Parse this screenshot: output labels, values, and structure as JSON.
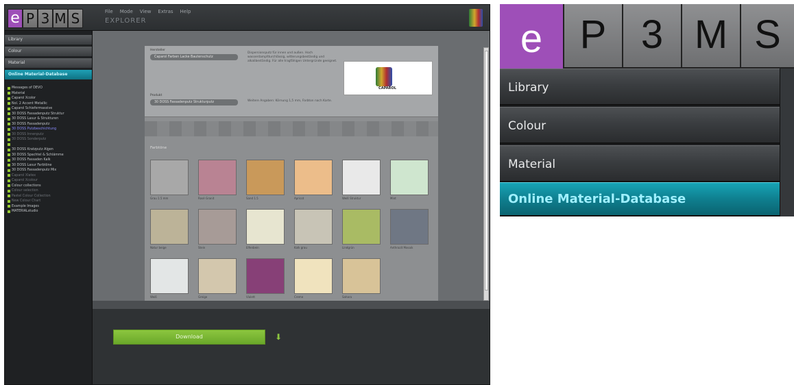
{
  "app": {
    "menu": [
      "File",
      "Mode",
      "View",
      "Extras",
      "Help"
    ],
    "explorer_title": "EXPLORER",
    "logo_letters": [
      "e",
      "P",
      "3",
      "M",
      "S"
    ]
  },
  "sidebar": {
    "items": [
      {
        "label": "Library"
      },
      {
        "label": "Colour"
      },
      {
        "label": "Material"
      },
      {
        "label": "Online Material-Database"
      }
    ]
  },
  "tree": {
    "rows": [
      {
        "label": "Messages of DEVO",
        "state": "normal"
      },
      {
        "label": "Material",
        "state": "normal"
      },
      {
        "label": "Caparol Xcolor",
        "state": "normal"
      },
      {
        "label": "Nol. 2 Accent Metallic",
        "state": "normal"
      },
      {
        "label": "Caparol Schiefermassive",
        "state": "normal"
      },
      {
        "label": "30 DOSS Fassadenputz Struktur",
        "state": "normal"
      },
      {
        "label": "30 DOSS Lasur & Strukturen",
        "state": "normal"
      },
      {
        "label": "30 DOSS Fassadenputz",
        "state": "normal"
      },
      {
        "label": "30 DOSS Putzbeschichtung",
        "state": "selected"
      },
      {
        "label": "30 DOSS Innenputz",
        "state": "dim"
      },
      {
        "label": "30 DOSS Sonderputz",
        "state": "dim"
      },
      {
        "label": "",
        "state": "dim"
      },
      {
        "label": "30 DOSS Kratzputz Algen",
        "state": "normal"
      },
      {
        "label": "30 DOSS Spachtel & Schlämme",
        "state": "normal"
      },
      {
        "label": "30 DOSS Fassaden Kalk",
        "state": "normal"
      },
      {
        "label": "30 DOSS Lasur Farbtöne",
        "state": "normal"
      },
      {
        "label": "30 DOSS Fassadenputz Mix",
        "state": "normal"
      },
      {
        "label": "Caparol Xlatex",
        "state": "dim"
      },
      {
        "label": "Caparol Xcolour",
        "state": "dim"
      },
      {
        "label": "Colour collections",
        "state": "normal"
      },
      {
        "label": "Colour selection",
        "state": "dim"
      },
      {
        "label": "Pastel Colour Collection",
        "state": "dim"
      },
      {
        "label": "New Colour Chart",
        "state": "dim"
      },
      {
        "label": "Example Images",
        "state": "normal"
      },
      {
        "label": "MATERIALstudio",
        "state": "normal"
      }
    ]
  },
  "document": {
    "manufacturer_label": "Hersteller",
    "manufacturer_value": "Caparol Farben Lacke Bautenschutz",
    "product_label": "Produkt",
    "product_value": "30 DOSS Fassadenputz Strukturputz",
    "description": "Dispersionsputz für innen und außen. Hoch wasserdampfdurchlässig, witterungsbeständig und alkalibeständig. Für alle tragfähigen Untergründe geeignet.",
    "additional_info": "Weitere Angaben: Körnung 1,5 mm, Farbton nach Karte.",
    "brand_name": "CAPAROL",
    "swatches_title": "Farbtöne",
    "swatches": [
      {
        "label": "Grau 1.5 mm",
        "color": "#a8a8a8"
      },
      {
        "label": "Rosé Granit",
        "color": "#b98393"
      },
      {
        "label": "Sand 1.5",
        "color": "#c9995a"
      },
      {
        "label": "Apricot",
        "color": "#ecbd8a"
      },
      {
        "label": "Weiß Struktur",
        "color": "#e9e9e9"
      },
      {
        "label": "Mint",
        "color": "#cfe6cf"
      },
      {
        "label": "Natur beige",
        "color": "#bcb398"
      },
      {
        "label": "Stein",
        "color": "#a79b97"
      },
      {
        "label": "Elfenbein",
        "color": "#e7e5d0"
      },
      {
        "label": "Kalk grau",
        "color": "#c8c4b6"
      },
      {
        "label": "Lindgrün",
        "color": "#a9bb64"
      },
      {
        "label": "Anthrazit Mosaik",
        "color": "#6f7784"
      },
      {
        "label": "Weiß",
        "color": "#e3e6e6"
      },
      {
        "label": "Greige",
        "color": "#d3c7ad"
      },
      {
        "label": "Violett",
        "color": "#874077"
      },
      {
        "label": "Creme",
        "color": "#f0e3be"
      },
      {
        "label": "Sahara",
        "color": "#d8c398"
      }
    ]
  },
  "footer": {
    "download_label": "Download",
    "download_icon": "download-arrow-icon"
  },
  "colors": {
    "brand_purple": "#9e4fb8",
    "active_teal": "#1396a8",
    "download_green": "#8cc63f"
  }
}
